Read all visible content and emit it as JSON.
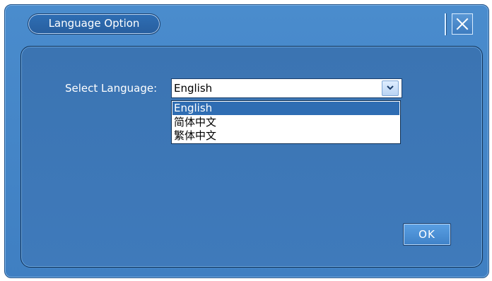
{
  "dialog": {
    "title": "Language Option",
    "close_icon": "close-icon",
    "select_label": "Select Language:",
    "selected_value": "English",
    "dropdown_icon": "chevron-down-icon",
    "options": [
      "English",
      "简体中文",
      "繁体中文"
    ],
    "ok_label": "OK"
  },
  "colors": {
    "window_bg": "#4a8ccd",
    "panel_bg": "#3b74b2",
    "selection": "#2f6db3",
    "text": "#ffffff"
  }
}
